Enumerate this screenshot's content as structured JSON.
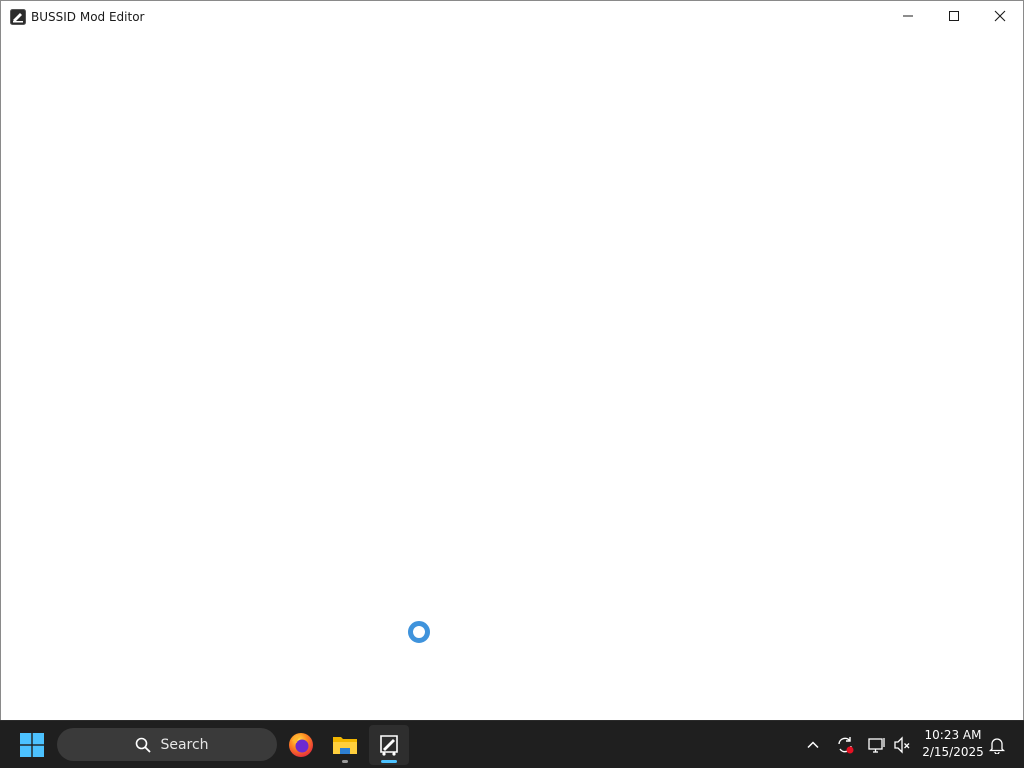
{
  "window": {
    "title": "BUSSID Mod Editor",
    "controls": {
      "minimize": "minimize-icon",
      "maximize": "maximize-icon",
      "close": "close-icon"
    }
  },
  "content": {
    "state": "loading",
    "spinner_color": "#3f93dc"
  },
  "taskbar": {
    "search_label": "Search",
    "apps": [
      {
        "name": "firefox",
        "icon": "firefox-icon"
      },
      {
        "name": "file-explorer",
        "icon": "folder-icon"
      },
      {
        "name": "bussid-mod-editor",
        "icon": "bus-editor-icon",
        "active": true
      }
    ],
    "tray": {
      "icons": [
        "chevron-up-icon",
        "sync-icon",
        "network-icon",
        "volume-muted-icon",
        "notification-bell-icon"
      ],
      "time": "10:23 AM",
      "date": "2/15/2025"
    },
    "accent": "#4cc2ff",
    "background": "#1f1f1f"
  }
}
